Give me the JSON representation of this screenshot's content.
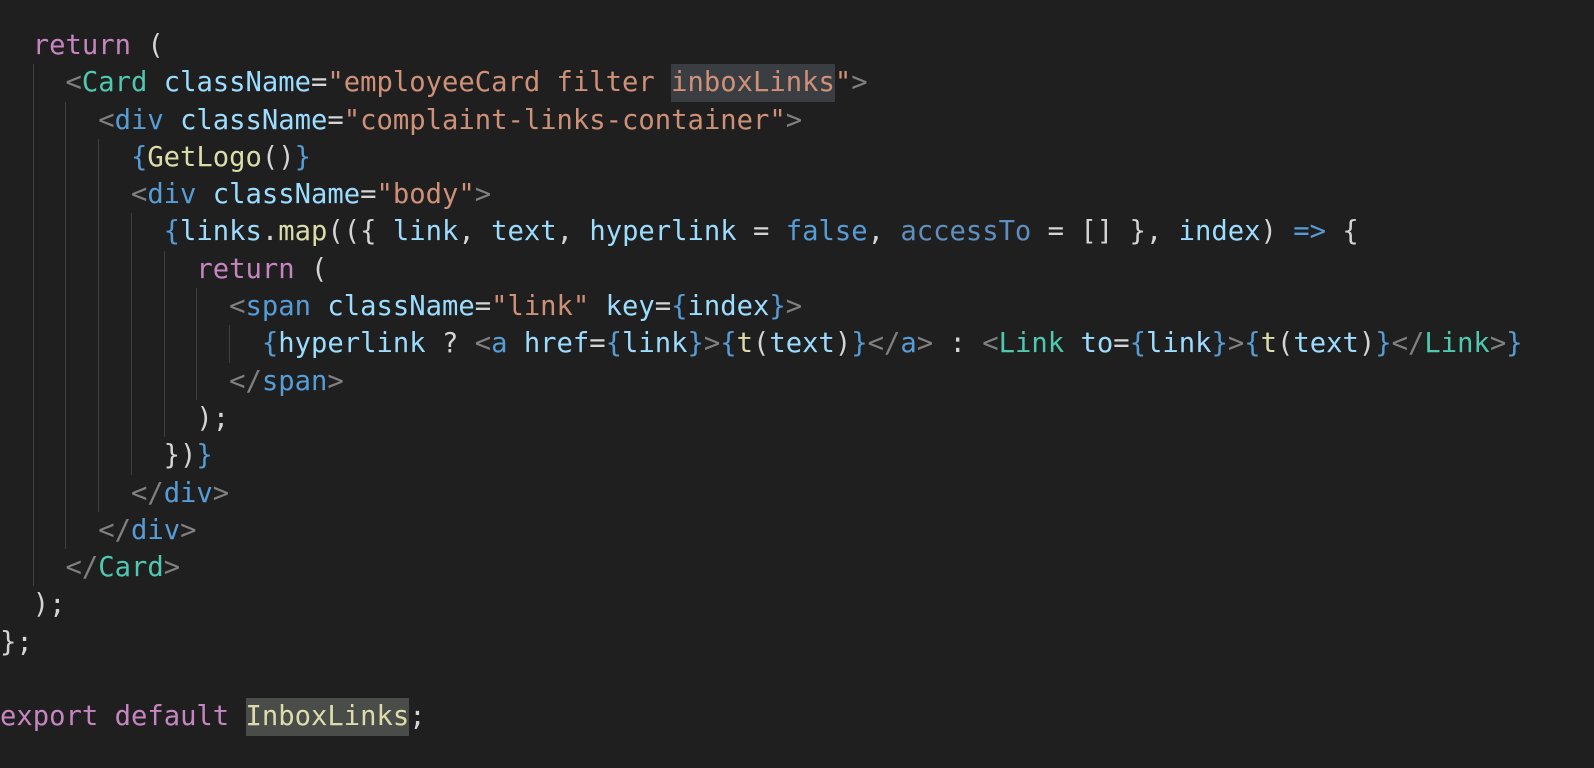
{
  "editor": {
    "lines": [
      {
        "indent": 1,
        "tokens": [
          [
            "return",
            "kw"
          ],
          [
            " (",
            "plain"
          ]
        ]
      },
      {
        "indent": 2,
        "tokens": [
          [
            "<",
            "punc"
          ],
          [
            "Card",
            "tag"
          ],
          [
            " ",
            "plain"
          ],
          [
            "className",
            "attr"
          ],
          [
            "=",
            "plain"
          ],
          [
            "\"employeeCard filter ",
            "str"
          ],
          [
            "inboxLinks",
            "str hl"
          ],
          [
            "\"",
            "str"
          ],
          [
            ">",
            "punc"
          ]
        ]
      },
      {
        "indent": 3,
        "tokens": [
          [
            "<",
            "punc"
          ],
          [
            "div",
            "html"
          ],
          [
            " ",
            "plain"
          ],
          [
            "className",
            "attr"
          ],
          [
            "=",
            "plain"
          ],
          [
            "\"complaint-links-container\"",
            "str"
          ],
          [
            ">",
            "punc"
          ]
        ]
      },
      {
        "indent": 4,
        "tokens": [
          [
            "{",
            "brace"
          ],
          [
            "GetLogo",
            "fn"
          ],
          [
            "()",
            "plain"
          ],
          [
            "}",
            "brace"
          ]
        ]
      },
      {
        "indent": 4,
        "tokens": [
          [
            "<",
            "punc"
          ],
          [
            "div",
            "html"
          ],
          [
            " ",
            "plain"
          ],
          [
            "className",
            "attr"
          ],
          [
            "=",
            "plain"
          ],
          [
            "\"body\"",
            "str"
          ],
          [
            ">",
            "punc"
          ]
        ]
      },
      {
        "indent": 5,
        "tokens": [
          [
            "{",
            "brace"
          ],
          [
            "links",
            "var"
          ],
          [
            ".",
            "plain"
          ],
          [
            "map",
            "fn"
          ],
          [
            "(({ ",
            "plain"
          ],
          [
            "link",
            "var"
          ],
          [
            ", ",
            "plain"
          ],
          [
            "text",
            "var"
          ],
          [
            ", ",
            "plain"
          ],
          [
            "hyperlink",
            "var"
          ],
          [
            " = ",
            "plain"
          ],
          [
            "false",
            "const"
          ],
          [
            ", ",
            "plain"
          ],
          [
            "accessTo",
            "unused"
          ],
          [
            " = [] }, ",
            "plain"
          ],
          [
            "index",
            "var"
          ],
          [
            ") ",
            "plain"
          ],
          [
            "=>",
            "const"
          ],
          [
            " {",
            "plain"
          ]
        ]
      },
      {
        "indent": 6,
        "tokens": [
          [
            "return",
            "kw"
          ],
          [
            " (",
            "plain"
          ]
        ]
      },
      {
        "indent": 7,
        "tokens": [
          [
            "<",
            "punc"
          ],
          [
            "span",
            "html"
          ],
          [
            " ",
            "plain"
          ],
          [
            "className",
            "attr"
          ],
          [
            "=",
            "plain"
          ],
          [
            "\"link\"",
            "str"
          ],
          [
            " ",
            "plain"
          ],
          [
            "key",
            "attr"
          ],
          [
            "=",
            "plain"
          ],
          [
            "{",
            "brace"
          ],
          [
            "index",
            "var"
          ],
          [
            "}",
            "brace"
          ],
          [
            ">",
            "punc"
          ]
        ]
      },
      {
        "indent": 8,
        "tokens": [
          [
            "{",
            "brace"
          ],
          [
            "hyperlink",
            "var"
          ],
          [
            " ? ",
            "plain"
          ],
          [
            "<",
            "punc"
          ],
          [
            "a",
            "html"
          ],
          [
            " ",
            "plain"
          ],
          [
            "href",
            "attr"
          ],
          [
            "=",
            "plain"
          ],
          [
            "{",
            "brace"
          ],
          [
            "link",
            "var"
          ],
          [
            "}",
            "brace"
          ],
          [
            ">",
            "punc"
          ],
          [
            "{",
            "brace"
          ],
          [
            "t",
            "fn"
          ],
          [
            "(",
            "plain"
          ],
          [
            "text",
            "var"
          ],
          [
            ")",
            "plain"
          ],
          [
            "}",
            "brace"
          ],
          [
            "</",
            "punc"
          ],
          [
            "a",
            "html"
          ],
          [
            ">",
            "punc"
          ],
          [
            " : ",
            "plain"
          ],
          [
            "<",
            "punc"
          ],
          [
            "Link",
            "tag"
          ],
          [
            " ",
            "plain"
          ],
          [
            "to",
            "attr"
          ],
          [
            "=",
            "plain"
          ],
          [
            "{",
            "brace"
          ],
          [
            "link",
            "var"
          ],
          [
            "}",
            "brace"
          ],
          [
            ">",
            "punc"
          ],
          [
            "{",
            "brace"
          ],
          [
            "t",
            "fn"
          ],
          [
            "(",
            "plain"
          ],
          [
            "text",
            "var"
          ],
          [
            ")",
            "plain"
          ],
          [
            "}",
            "brace"
          ],
          [
            "</",
            "punc"
          ],
          [
            "Link",
            "tag"
          ],
          [
            ">",
            "punc"
          ],
          [
            "}",
            "brace"
          ]
        ]
      },
      {
        "indent": 7,
        "tokens": [
          [
            "</",
            "punc"
          ],
          [
            "span",
            "html"
          ],
          [
            ">",
            "punc"
          ]
        ]
      },
      {
        "indent": 6,
        "tokens": [
          [
            ");",
            "plain"
          ]
        ]
      },
      {
        "indent": 5,
        "tokens": [
          [
            "})",
            "plain"
          ],
          [
            "}",
            "brace"
          ]
        ]
      },
      {
        "indent": 4,
        "tokens": [
          [
            "</",
            "punc"
          ],
          [
            "div",
            "html"
          ],
          [
            ">",
            "punc"
          ]
        ]
      },
      {
        "indent": 3,
        "tokens": [
          [
            "</",
            "punc"
          ],
          [
            "div",
            "html"
          ],
          [
            ">",
            "punc"
          ]
        ]
      },
      {
        "indent": 2,
        "tokens": [
          [
            "</",
            "punc"
          ],
          [
            "Card",
            "tag"
          ],
          [
            ">",
            "punc"
          ]
        ]
      },
      {
        "indent": 1,
        "tokens": [
          [
            ");",
            "plain"
          ]
        ]
      },
      {
        "indent": 0,
        "tokens": [
          [
            "};",
            "plain"
          ]
        ]
      },
      {
        "indent": 0,
        "tokens": []
      },
      {
        "indent": 0,
        "tokens": [
          [
            "export",
            "kw"
          ],
          [
            " ",
            "plain"
          ],
          [
            "default",
            "kw"
          ],
          [
            " ",
            "plain"
          ],
          [
            "InboxLinks",
            "fn hl2"
          ],
          [
            ";",
            "plain"
          ]
        ]
      }
    ]
  }
}
